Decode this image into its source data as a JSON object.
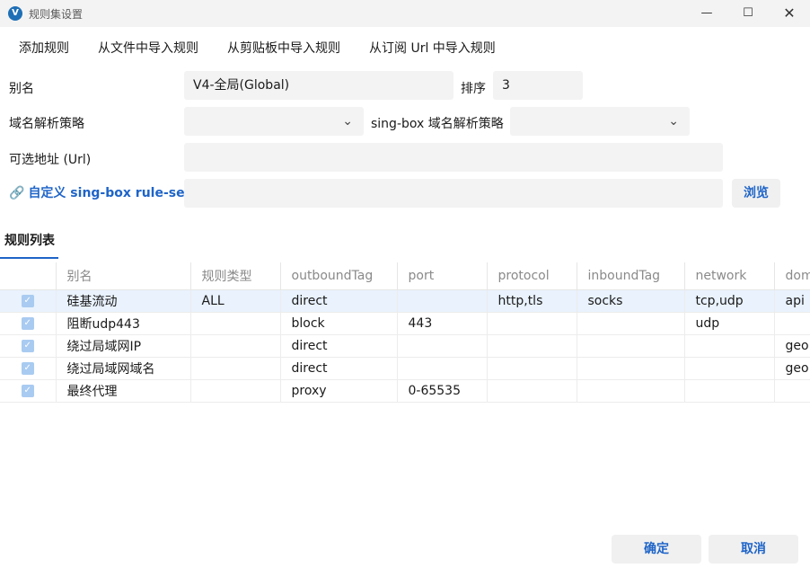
{
  "window": {
    "app_icon": "V",
    "title": "规则集设置",
    "minimize_glyph": "—",
    "maximize_glyph": "☐",
    "close_glyph": "✕"
  },
  "menu": {
    "add_rule": "添加规则",
    "import_from_file": "从文件中导入规则",
    "import_from_clipboard": "从剪贴板中导入规则",
    "import_from_url": "从订阅 Url 中导入规则"
  },
  "form": {
    "alias_label": "别名",
    "alias_value": "V4-全局(Global)",
    "sort_label": "排序",
    "sort_value": "3",
    "domain_strategy_label": "域名解析策略",
    "domain_strategy_value": "",
    "singbox_strategy_label": "sing-box 域名解析策略",
    "singbox_strategy_value": "",
    "url_label": "可选地址 (Url)",
    "url_value": "",
    "ruleset_label": "自定义 sing-box rule-set",
    "ruleset_value": "",
    "browse_label": "浏览",
    "chevron_glyph": "⌄",
    "link_glyph": "🔗"
  },
  "tab": {
    "label": "规则列表"
  },
  "table": {
    "headers": [
      "",
      "别名",
      "规则类型",
      "outboundTag",
      "port",
      "protocol",
      "inboundTag",
      "network",
      "domain"
    ],
    "rows": [
      {
        "checked": true,
        "cells": [
          "硅基流动",
          "ALL",
          "direct",
          "",
          "http,tls",
          "socks",
          "tcp,udp",
          "api"
        ]
      },
      {
        "checked": true,
        "cells": [
          "阻断udp443",
          "",
          "block",
          "443",
          "",
          "",
          "udp",
          ""
        ]
      },
      {
        "checked": true,
        "cells": [
          "绕过局域网IP",
          "",
          "direct",
          "",
          "",
          "",
          "",
          "geo"
        ]
      },
      {
        "checked": true,
        "cells": [
          "绕过局域网域名",
          "",
          "direct",
          "",
          "",
          "",
          "",
          "geo"
        ]
      },
      {
        "checked": true,
        "cells": [
          "最终代理",
          "",
          "proxy",
          "0-65535",
          "",
          "",
          "",
          ""
        ]
      }
    ],
    "check_glyph": "✓"
  },
  "footer": {
    "ok_label": "确定",
    "cancel_label": "取消"
  },
  "colors": {
    "accent": "#1e64c8",
    "selected_row": "#e9f2fd",
    "field_bg": "#f3f3f3",
    "checkbox": "#a9cbf1"
  }
}
